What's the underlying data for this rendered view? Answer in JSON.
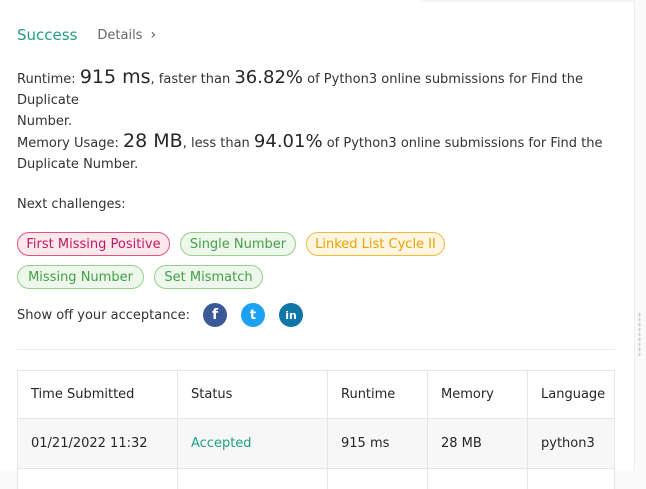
{
  "result": {
    "status": "Success",
    "details_label": "Details"
  },
  "runtime": {
    "label": "Runtime: ",
    "value": "915 ms",
    "mid": ", faster than ",
    "percent": "36.82%",
    "line1_tail": " of Python3 online submissions for Find the Duplicate",
    "line2": "Number."
  },
  "memory": {
    "label": "Memory Usage: ",
    "value": "28 MB",
    "mid": ", less than ",
    "percent": "94.01%",
    "line1_tail": " of Python3 online submissions for Find the",
    "line2": "Duplicate Number."
  },
  "next_challenges": {
    "label": "Next challenges:",
    "items": [
      {
        "label": "First Missing Positive",
        "difficulty": "hard"
      },
      {
        "label": "Single Number",
        "difficulty": "easy"
      },
      {
        "label": "Linked List Cycle II",
        "difficulty": "medium"
      },
      {
        "label": "Missing Number",
        "difficulty": "easy"
      },
      {
        "label": "Set Mismatch",
        "difficulty": "easy"
      }
    ]
  },
  "share": {
    "label": "Show off your acceptance:",
    "icons": [
      {
        "name": "facebook-icon",
        "glyph": "f",
        "color": "#3b5998"
      },
      {
        "name": "twitter-icon",
        "glyph": "t",
        "color": "#1da1f2"
      },
      {
        "name": "linkedin-icon",
        "glyph": "in",
        "color": "#0e76a8"
      }
    ]
  },
  "table": {
    "headers": [
      "Time Submitted",
      "Status",
      "Runtime",
      "Memory",
      "Language"
    ],
    "rows": [
      [
        "01/21/2022 11:32",
        "Accepted",
        "915 ms",
        "28 MB",
        "python3"
      ]
    ]
  },
  "colors": {
    "accent": "#1f9e87",
    "hard": "#e3557e",
    "easy": "#97d08a",
    "medium": "#f4b844"
  }
}
